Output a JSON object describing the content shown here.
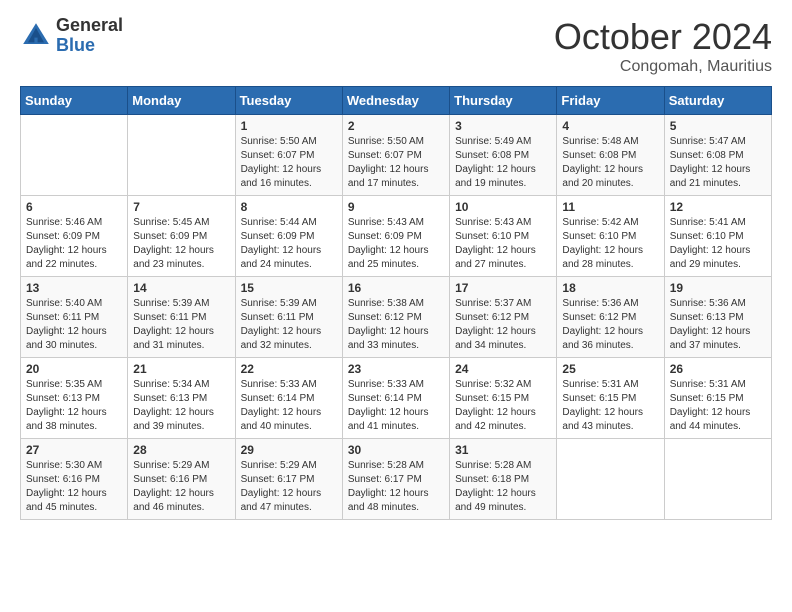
{
  "logo": {
    "general": "General",
    "blue": "Blue"
  },
  "header": {
    "month_year": "October 2024",
    "location": "Congomah, Mauritius"
  },
  "days_of_week": [
    "Sunday",
    "Monday",
    "Tuesday",
    "Wednesday",
    "Thursday",
    "Friday",
    "Saturday"
  ],
  "weeks": [
    [
      {
        "day": "",
        "sunrise": "",
        "sunset": "",
        "daylight": ""
      },
      {
        "day": "",
        "sunrise": "",
        "sunset": "",
        "daylight": ""
      },
      {
        "day": "1",
        "sunrise": "Sunrise: 5:50 AM",
        "sunset": "Sunset: 6:07 PM",
        "daylight": "Daylight: 12 hours and 16 minutes."
      },
      {
        "day": "2",
        "sunrise": "Sunrise: 5:50 AM",
        "sunset": "Sunset: 6:07 PM",
        "daylight": "Daylight: 12 hours and 17 minutes."
      },
      {
        "day": "3",
        "sunrise": "Sunrise: 5:49 AM",
        "sunset": "Sunset: 6:08 PM",
        "daylight": "Daylight: 12 hours and 19 minutes."
      },
      {
        "day": "4",
        "sunrise": "Sunrise: 5:48 AM",
        "sunset": "Sunset: 6:08 PM",
        "daylight": "Daylight: 12 hours and 20 minutes."
      },
      {
        "day": "5",
        "sunrise": "Sunrise: 5:47 AM",
        "sunset": "Sunset: 6:08 PM",
        "daylight": "Daylight: 12 hours and 21 minutes."
      }
    ],
    [
      {
        "day": "6",
        "sunrise": "Sunrise: 5:46 AM",
        "sunset": "Sunset: 6:09 PM",
        "daylight": "Daylight: 12 hours and 22 minutes."
      },
      {
        "day": "7",
        "sunrise": "Sunrise: 5:45 AM",
        "sunset": "Sunset: 6:09 PM",
        "daylight": "Daylight: 12 hours and 23 minutes."
      },
      {
        "day": "8",
        "sunrise": "Sunrise: 5:44 AM",
        "sunset": "Sunset: 6:09 PM",
        "daylight": "Daylight: 12 hours and 24 minutes."
      },
      {
        "day": "9",
        "sunrise": "Sunrise: 5:43 AM",
        "sunset": "Sunset: 6:09 PM",
        "daylight": "Daylight: 12 hours and 25 minutes."
      },
      {
        "day": "10",
        "sunrise": "Sunrise: 5:43 AM",
        "sunset": "Sunset: 6:10 PM",
        "daylight": "Daylight: 12 hours and 27 minutes."
      },
      {
        "day": "11",
        "sunrise": "Sunrise: 5:42 AM",
        "sunset": "Sunset: 6:10 PM",
        "daylight": "Daylight: 12 hours and 28 minutes."
      },
      {
        "day": "12",
        "sunrise": "Sunrise: 5:41 AM",
        "sunset": "Sunset: 6:10 PM",
        "daylight": "Daylight: 12 hours and 29 minutes."
      }
    ],
    [
      {
        "day": "13",
        "sunrise": "Sunrise: 5:40 AM",
        "sunset": "Sunset: 6:11 PM",
        "daylight": "Daylight: 12 hours and 30 minutes."
      },
      {
        "day": "14",
        "sunrise": "Sunrise: 5:39 AM",
        "sunset": "Sunset: 6:11 PM",
        "daylight": "Daylight: 12 hours and 31 minutes."
      },
      {
        "day": "15",
        "sunrise": "Sunrise: 5:39 AM",
        "sunset": "Sunset: 6:11 PM",
        "daylight": "Daylight: 12 hours and 32 minutes."
      },
      {
        "day": "16",
        "sunrise": "Sunrise: 5:38 AM",
        "sunset": "Sunset: 6:12 PM",
        "daylight": "Daylight: 12 hours and 33 minutes."
      },
      {
        "day": "17",
        "sunrise": "Sunrise: 5:37 AM",
        "sunset": "Sunset: 6:12 PM",
        "daylight": "Daylight: 12 hours and 34 minutes."
      },
      {
        "day": "18",
        "sunrise": "Sunrise: 5:36 AM",
        "sunset": "Sunset: 6:12 PM",
        "daylight": "Daylight: 12 hours and 36 minutes."
      },
      {
        "day": "19",
        "sunrise": "Sunrise: 5:36 AM",
        "sunset": "Sunset: 6:13 PM",
        "daylight": "Daylight: 12 hours and 37 minutes."
      }
    ],
    [
      {
        "day": "20",
        "sunrise": "Sunrise: 5:35 AM",
        "sunset": "Sunset: 6:13 PM",
        "daylight": "Daylight: 12 hours and 38 minutes."
      },
      {
        "day": "21",
        "sunrise": "Sunrise: 5:34 AM",
        "sunset": "Sunset: 6:13 PM",
        "daylight": "Daylight: 12 hours and 39 minutes."
      },
      {
        "day": "22",
        "sunrise": "Sunrise: 5:33 AM",
        "sunset": "Sunset: 6:14 PM",
        "daylight": "Daylight: 12 hours and 40 minutes."
      },
      {
        "day": "23",
        "sunrise": "Sunrise: 5:33 AM",
        "sunset": "Sunset: 6:14 PM",
        "daylight": "Daylight: 12 hours and 41 minutes."
      },
      {
        "day": "24",
        "sunrise": "Sunrise: 5:32 AM",
        "sunset": "Sunset: 6:15 PM",
        "daylight": "Daylight: 12 hours and 42 minutes."
      },
      {
        "day": "25",
        "sunrise": "Sunrise: 5:31 AM",
        "sunset": "Sunset: 6:15 PM",
        "daylight": "Daylight: 12 hours and 43 minutes."
      },
      {
        "day": "26",
        "sunrise": "Sunrise: 5:31 AM",
        "sunset": "Sunset: 6:15 PM",
        "daylight": "Daylight: 12 hours and 44 minutes."
      }
    ],
    [
      {
        "day": "27",
        "sunrise": "Sunrise: 5:30 AM",
        "sunset": "Sunset: 6:16 PM",
        "daylight": "Daylight: 12 hours and 45 minutes."
      },
      {
        "day": "28",
        "sunrise": "Sunrise: 5:29 AM",
        "sunset": "Sunset: 6:16 PM",
        "daylight": "Daylight: 12 hours and 46 minutes."
      },
      {
        "day": "29",
        "sunrise": "Sunrise: 5:29 AM",
        "sunset": "Sunset: 6:17 PM",
        "daylight": "Daylight: 12 hours and 47 minutes."
      },
      {
        "day": "30",
        "sunrise": "Sunrise: 5:28 AM",
        "sunset": "Sunset: 6:17 PM",
        "daylight": "Daylight: 12 hours and 48 minutes."
      },
      {
        "day": "31",
        "sunrise": "Sunrise: 5:28 AM",
        "sunset": "Sunset: 6:18 PM",
        "daylight": "Daylight: 12 hours and 49 minutes."
      },
      {
        "day": "",
        "sunrise": "",
        "sunset": "",
        "daylight": ""
      },
      {
        "day": "",
        "sunrise": "",
        "sunset": "",
        "daylight": ""
      }
    ]
  ]
}
